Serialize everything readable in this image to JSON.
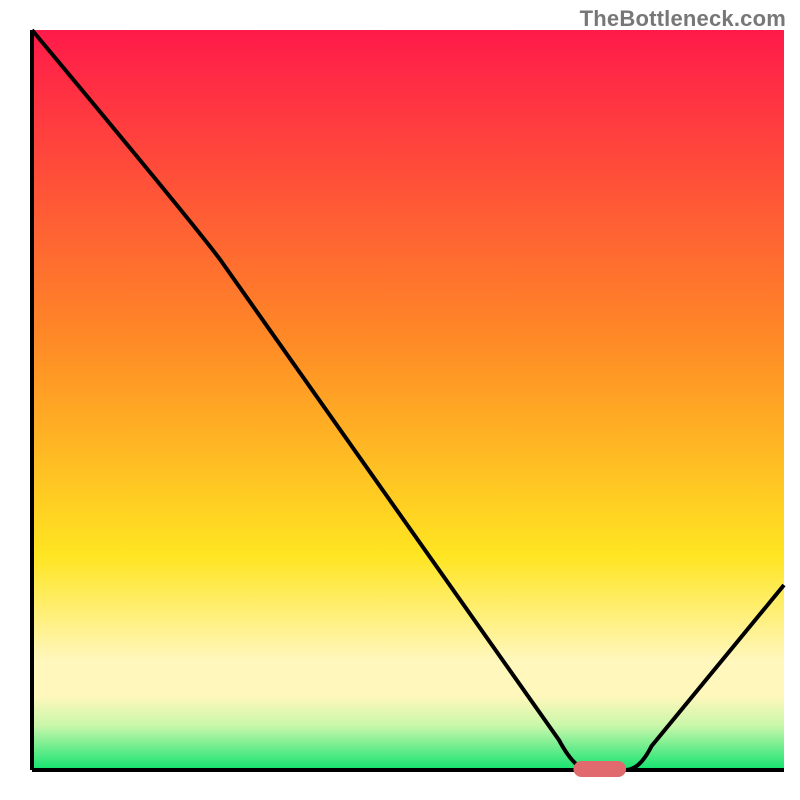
{
  "watermark": "TheBottleneck.com",
  "colors": {
    "red": "#ff1a4a",
    "orange": "#ff8a26",
    "yellow": "#ffe521",
    "yellow_pale": "#fff7bb",
    "green_pale": "#c9f7aa",
    "green": "#12e36f",
    "curve": "#000000",
    "marker": "#e06a6d",
    "axis": "#000000"
  },
  "chart_data": {
    "type": "line",
    "title": "",
    "xlabel": "",
    "ylabel": "",
    "xlim": [
      0,
      100
    ],
    "ylim": [
      0,
      100
    ],
    "x": [
      0,
      25,
      73,
      80,
      100
    ],
    "y": [
      100,
      69,
      0,
      0,
      25
    ],
    "marker": {
      "x_start": 72,
      "x_end": 79,
      "y": 0
    },
    "gradient_stops_pct": [
      0,
      42,
      71,
      85,
      90,
      94,
      100
    ],
    "notes": "Heat gradient backdrop red→orange→yellow→pale→green. Black curve descends steeply, flattens at bottom (x≈73–80), then rises to top-right. Red pill marker sits on the flat minimum."
  }
}
